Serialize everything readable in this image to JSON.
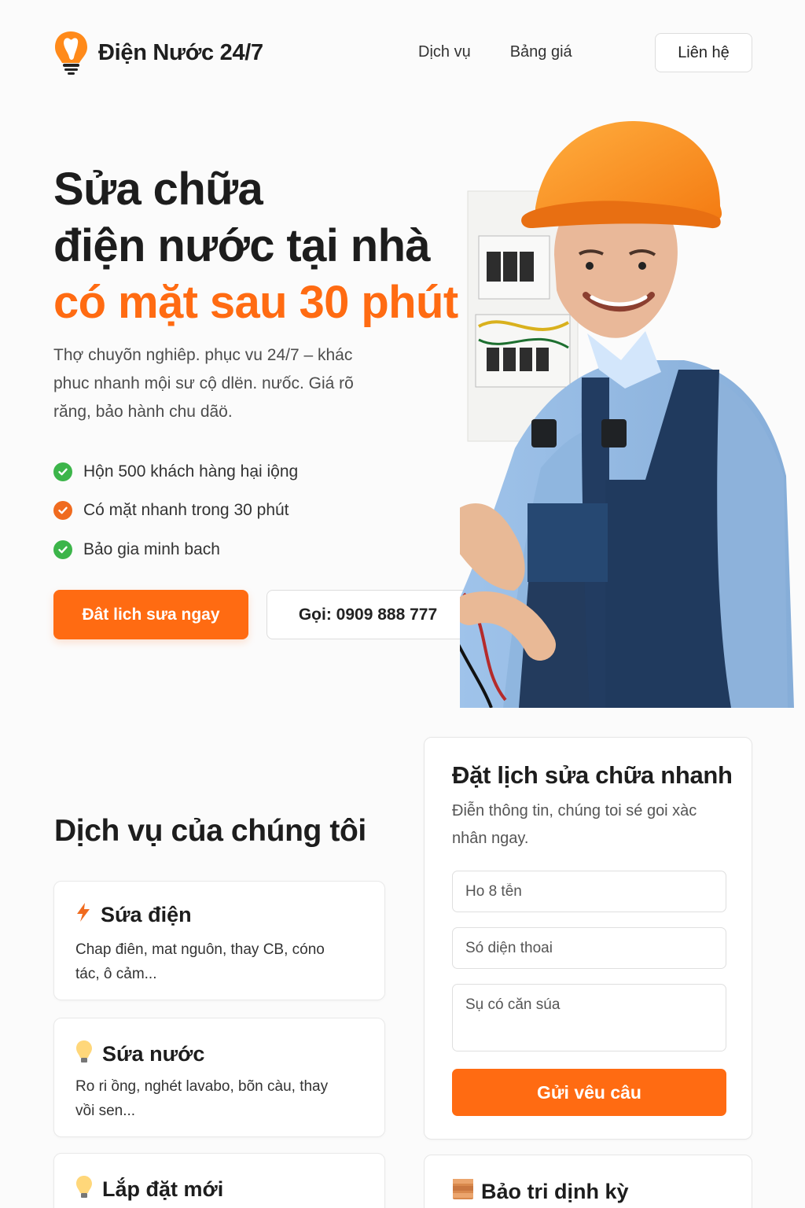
{
  "header": {
    "brand": "Điện Nước 24/7",
    "nav": [
      "Dịch vụ",
      "Bảng giá"
    ],
    "contact": "Liên hệ"
  },
  "hero": {
    "title_line1": "Sửa chữa",
    "title_line2": "điện nước tại nhà",
    "title_line3": "có mặt sau 30 phút",
    "description": "Thợ chuyõn nghiêp. phục vu 24/7 – khác phuc nhanh mội sư cộ dlën. nưốc. Giá rõ răng, bảo hành chu dãö.",
    "checks": [
      {
        "label": "Hộn 500 khách hàng hại iộng",
        "icon": "check-circle-icon",
        "color": "#3cb54a"
      },
      {
        "label": "Có mặt nhanh trong 30 phút",
        "icon": "check-circle-icon",
        "color": "#f06b1f"
      },
      {
        "label": "Bảo gia minh bach",
        "icon": "check-circle-icon",
        "color": "#3cb54a"
      }
    ],
    "primary_button": "Đât lich sưa ngay",
    "call_button": "Gọi: 0909 888 777",
    "image": "technician-with-multimeter"
  },
  "services": {
    "title": "Dịch vụ của chúng tôi",
    "items": [
      {
        "title": "Sứa điện",
        "description": "Chap điên, mat nguôn, thay CB, cóno tác, ô cảm...",
        "icon": "lightning-icon"
      },
      {
        "title": "Sứa nước",
        "description": "Ro ri ồng, nghét lavabo, bõn càu, thay vồi sen...",
        "icon": "lightbulb-icon"
      },
      {
        "title": "Lắp đặt mới",
        "description": "",
        "icon": "lightbulb-icon"
      }
    ]
  },
  "booking": {
    "title": "Đặt lịch sửa chữa nhanh",
    "subtitle": "Điễn thông tin, chúng toi sé goi xàc nhân ngay.",
    "name_placeholder": "Ho 8 tễn",
    "phone_placeholder": "Só diện thoai",
    "issue_placeholder": "Sụ có căn súa",
    "submit": "Gửi vêu câu"
  },
  "maintenance": {
    "title": "Bảo tri dịnh kỳ",
    "icon": "wood-panel-icon"
  },
  "colors": {
    "accent": "#ff6b12",
    "green": "#3cb54a",
    "text": "#1d1d1d"
  }
}
